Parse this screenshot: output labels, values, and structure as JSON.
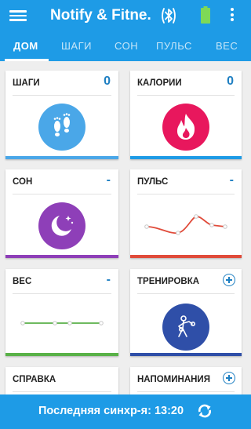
{
  "app": {
    "title": "Notify & Fitne..."
  },
  "colors": {
    "primary": "#1e9be6",
    "steps": "#4aa7e8",
    "calories": "#e8175d",
    "sleep": "#8e3fb8",
    "pulse": "#e04b3a",
    "weight": "#59b148",
    "workout": "#2f4fa8"
  },
  "icons": {
    "menu": "menu-icon",
    "bluetooth": "bluetooth-icon",
    "battery": "battery-icon",
    "more": "more-vert-icon",
    "sync": "sync-icon"
  },
  "tabs": [
    {
      "label": "ДОМ",
      "active": true
    },
    {
      "label": "ШАГИ"
    },
    {
      "label": "СОН"
    },
    {
      "label": "ПУЛЬС"
    },
    {
      "label": "ВЕС"
    }
  ],
  "cards": {
    "steps": {
      "label": "ШАГИ",
      "value": "0"
    },
    "calories": {
      "label": "КАЛОРИИ",
      "value": "0"
    },
    "sleep": {
      "label": "СОН",
      "value": "-"
    },
    "pulse": {
      "label": "ПУЛЬС",
      "value": "-"
    },
    "weight": {
      "label": "ВЕС",
      "value": "-"
    },
    "workout": {
      "label": "ТРЕНИРОВКА"
    },
    "help": {
      "label": "СПРАВКА"
    },
    "reminders": {
      "label": "НАПОМИНАНИЯ"
    }
  },
  "footer": {
    "sync_text": "Последняя синхр-я: 13:20"
  }
}
